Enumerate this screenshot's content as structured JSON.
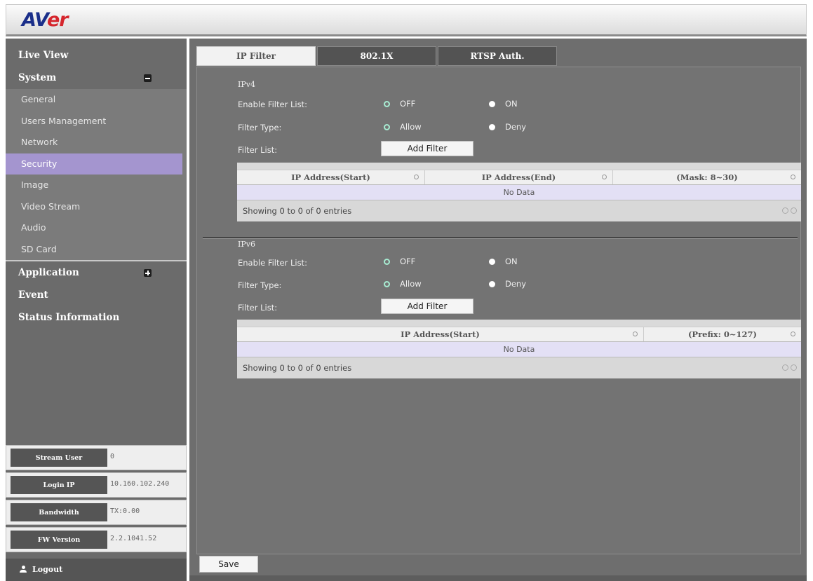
{
  "brand": {
    "logo_a": "AV",
    "logo_b": "er"
  },
  "sidebar": {
    "live_view": "Live View",
    "system": "System",
    "sub_items": [
      "General",
      "Users Management",
      "Network",
      "Security",
      "Image",
      "Video Stream",
      "Audio",
      "SD Card"
    ],
    "application": "Application",
    "event": "Event",
    "status_information": "Status Information",
    "info": [
      {
        "label": "Stream User",
        "value": "0"
      },
      {
        "label": "Login IP",
        "value": "10.160.102.240"
      },
      {
        "label": "Bandwidth",
        "value": "TX:0.00"
      },
      {
        "label": "FW Version",
        "value": "2.2.1041.52"
      }
    ],
    "logout": "Logout"
  },
  "tabs": [
    "IP Filter",
    "802.1X",
    "RTSP Auth."
  ],
  "ipv4": {
    "title": "IPv4",
    "enable_label": "Enable Filter List:",
    "off": "OFF",
    "on": "ON",
    "type_label": "Filter Type:",
    "allow": "Allow",
    "deny": "Deny",
    "list_label": "Filter List:",
    "add_button": "Add Filter",
    "columns": [
      "IP Address(Start)",
      "IP Address(End)",
      "(Mask: 8~30)"
    ],
    "no_data": "No Data",
    "showing": "Showing 0 to 0 of 0 entries"
  },
  "ipv6": {
    "title": "IPv6",
    "enable_label": "Enable Filter List:",
    "off": "OFF",
    "on": "ON",
    "type_label": "Filter Type:",
    "allow": "Allow",
    "deny": "Deny",
    "list_label": "Filter List:",
    "add_button": "Add Filter",
    "columns": [
      "IP Address(Start)",
      "(Prefix: 0~127)"
    ],
    "no_data": "No Data",
    "showing": "Showing 0 to 0 of 0 entries"
  },
  "save_label": "Save",
  "colors": {
    "active_nav": "#a495cf",
    "radio_checked": "#a7ecd2",
    "logo_blue": "#1b2f8a",
    "logo_red": "#d5262d"
  }
}
